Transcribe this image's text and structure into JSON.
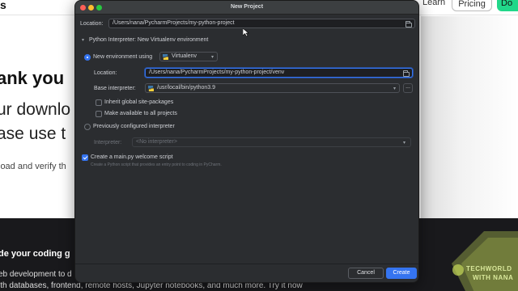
{
  "background_page": {
    "logo_fragment": "s",
    "nav": {
      "learn": "Learn",
      "pricing": "Pricing",
      "extra": "Do"
    },
    "heading": "ank you",
    "subtitle_line1": "ur downlo",
    "subtitle_line2": "ase use t",
    "small_text": "load and verify th",
    "dark_heading": "de your coding g",
    "dark_text1": "eb development to d",
    "dark_text2": "ith databases, frontend, remote hosts, Jupyter notebooks, and much more. Try it now",
    "watermark_line1": "TECHWORLD",
    "watermark_line2": "WITH NANA"
  },
  "dialog": {
    "title": "New Project",
    "location_label": "Location:",
    "location_value": "/Users/nana/PycharmProjects/my-python-project",
    "interpreter_section": "Python Interpreter: New Virtualenv environment",
    "new_env_label": "New environment using",
    "env_tool": "Virtualenv",
    "venv_location_label": "Location:",
    "venv_location_value": "/Users/nana/PycharmProjects/my-python-project/venv",
    "base_interpreter_label": "Base interpreter:",
    "base_interpreter_value": "/usr/local/bin/python3.9",
    "dots_label": "...",
    "inherit_label": "Inherit global site-packages",
    "make_available_label": "Make available to all projects",
    "previous_label": "Previously configured interpreter",
    "interpreter_label": "Interpreter:",
    "interpreter_value": "<No interpreter>",
    "welcome_label": "Create a main.py welcome script",
    "welcome_hint": "Create a Python script that provides an entry point to coding in PyCharm.",
    "cancel": "Cancel",
    "create": "Create"
  },
  "icons": [
    "folder-icon",
    "chevron-down-icon",
    "python-icon",
    "cursor-icon"
  ],
  "colors": {
    "accent": "#3574f0",
    "dialog_bg": "#2b2d30",
    "watermark": "#c7dc5a"
  }
}
